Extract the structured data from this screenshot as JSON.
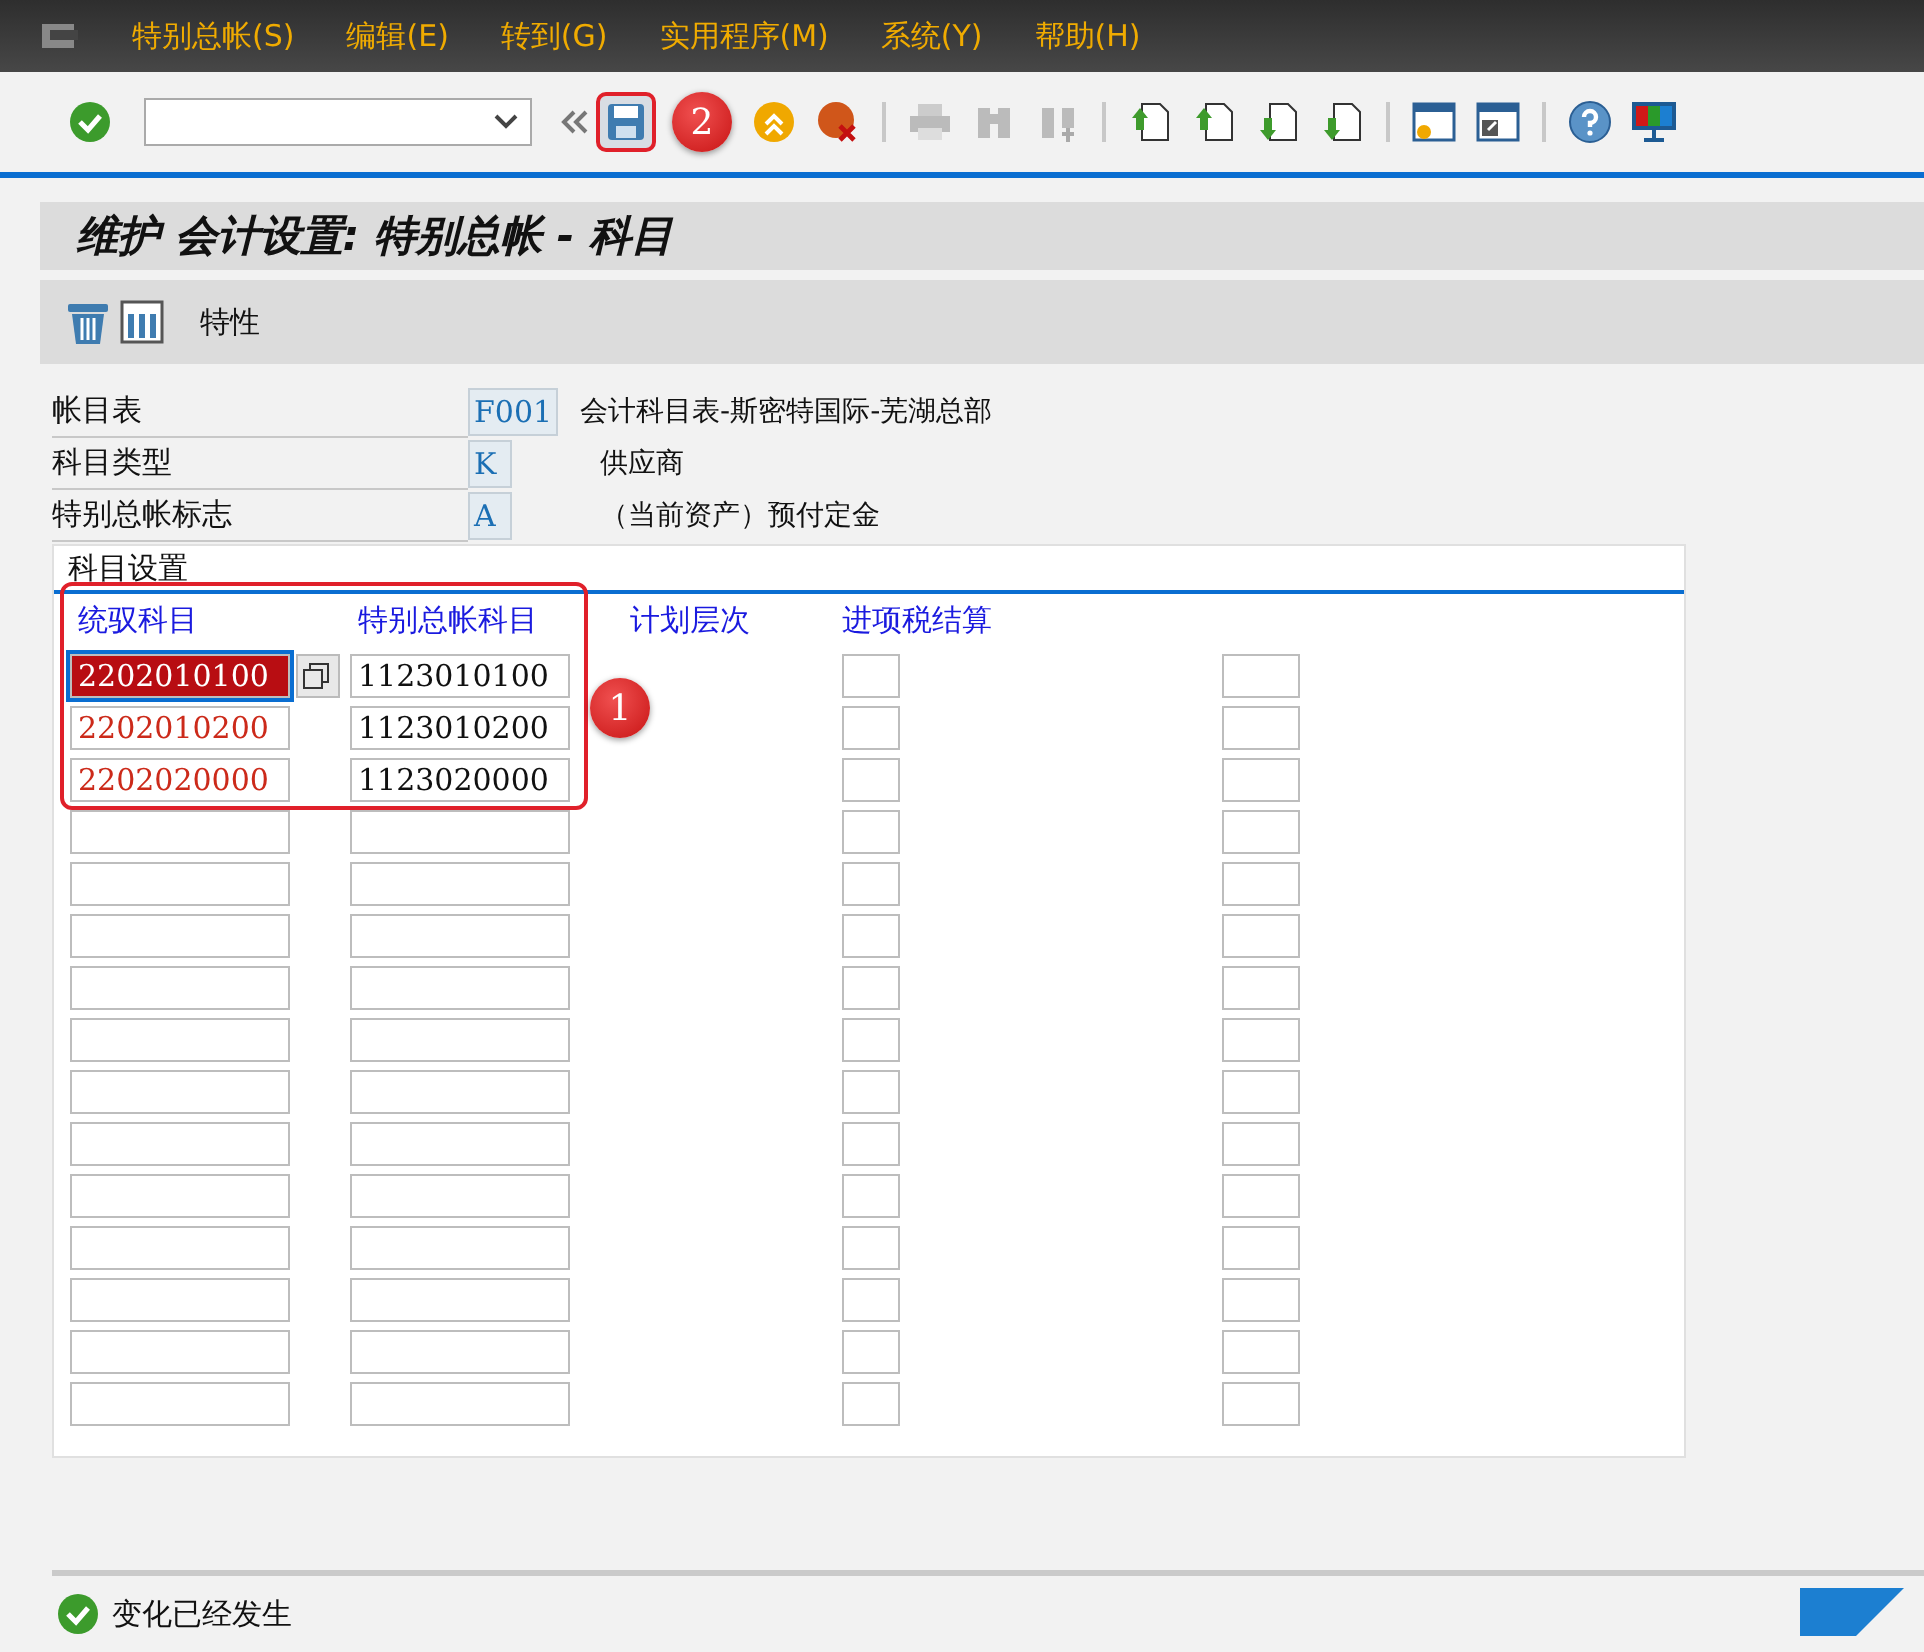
{
  "menu_bar": {
    "items": [
      "特别总帐(S)",
      "编辑(E)",
      "转到(G)",
      "实用程序(M)",
      "系统(Y)",
      "帮助(H)"
    ]
  },
  "title": "维护 会计设置: 特别总帐 - 科目",
  "app_toolbar": {
    "button": "特性"
  },
  "header_fields": [
    {
      "label": "帐目表",
      "value": "F001",
      "description": "会计科目表-斯密特国际-芜湖总部"
    },
    {
      "label": "科目类型",
      "value": "K",
      "description": "供应商"
    },
    {
      "label": "特别总帐标志",
      "value": "A",
      "description": "（当前资产）预付定金"
    }
  ],
  "group": {
    "title": "科目设置",
    "columns": [
      "统驭科目",
      "特别总帐科目",
      "计划层次",
      "进项税结算"
    ],
    "rows": [
      {
        "recon_account": "2202010100",
        "special_gl_account": "1123010100",
        "selected": true
      },
      {
        "recon_account": "2202010200",
        "special_gl_account": "1123010200",
        "selected": false
      },
      {
        "recon_account": "2202020000",
        "special_gl_account": "1123020000",
        "selected": false
      },
      {
        "selected": false
      },
      {
        "selected": false
      },
      {
        "selected": false
      },
      {
        "selected": false
      },
      {
        "selected": false
      },
      {
        "selected": false
      },
      {
        "selected": false
      },
      {
        "selected": false
      },
      {
        "selected": false
      },
      {
        "selected": false
      },
      {
        "selected": false
      },
      {
        "selected": false
      }
    ]
  },
  "annotations": {
    "table_marker": "1",
    "save_marker": "2"
  },
  "status_bar": {
    "message": "变化已经发生"
  }
}
